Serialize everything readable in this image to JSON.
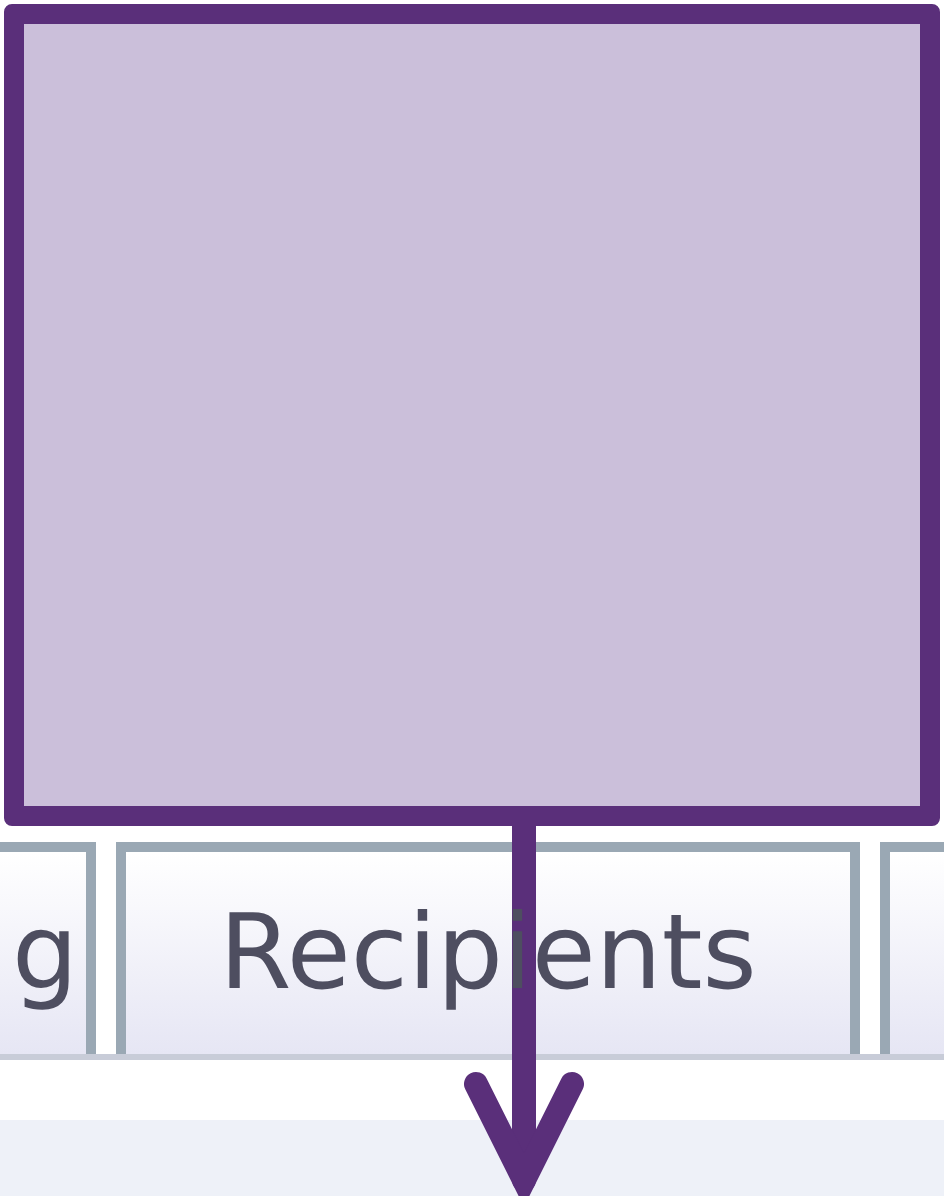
{
  "tabs": [
    {
      "label": "g",
      "selected": false
    },
    {
      "label": "Recipients",
      "selected": false
    },
    {
      "selected": false
    }
  ]
}
